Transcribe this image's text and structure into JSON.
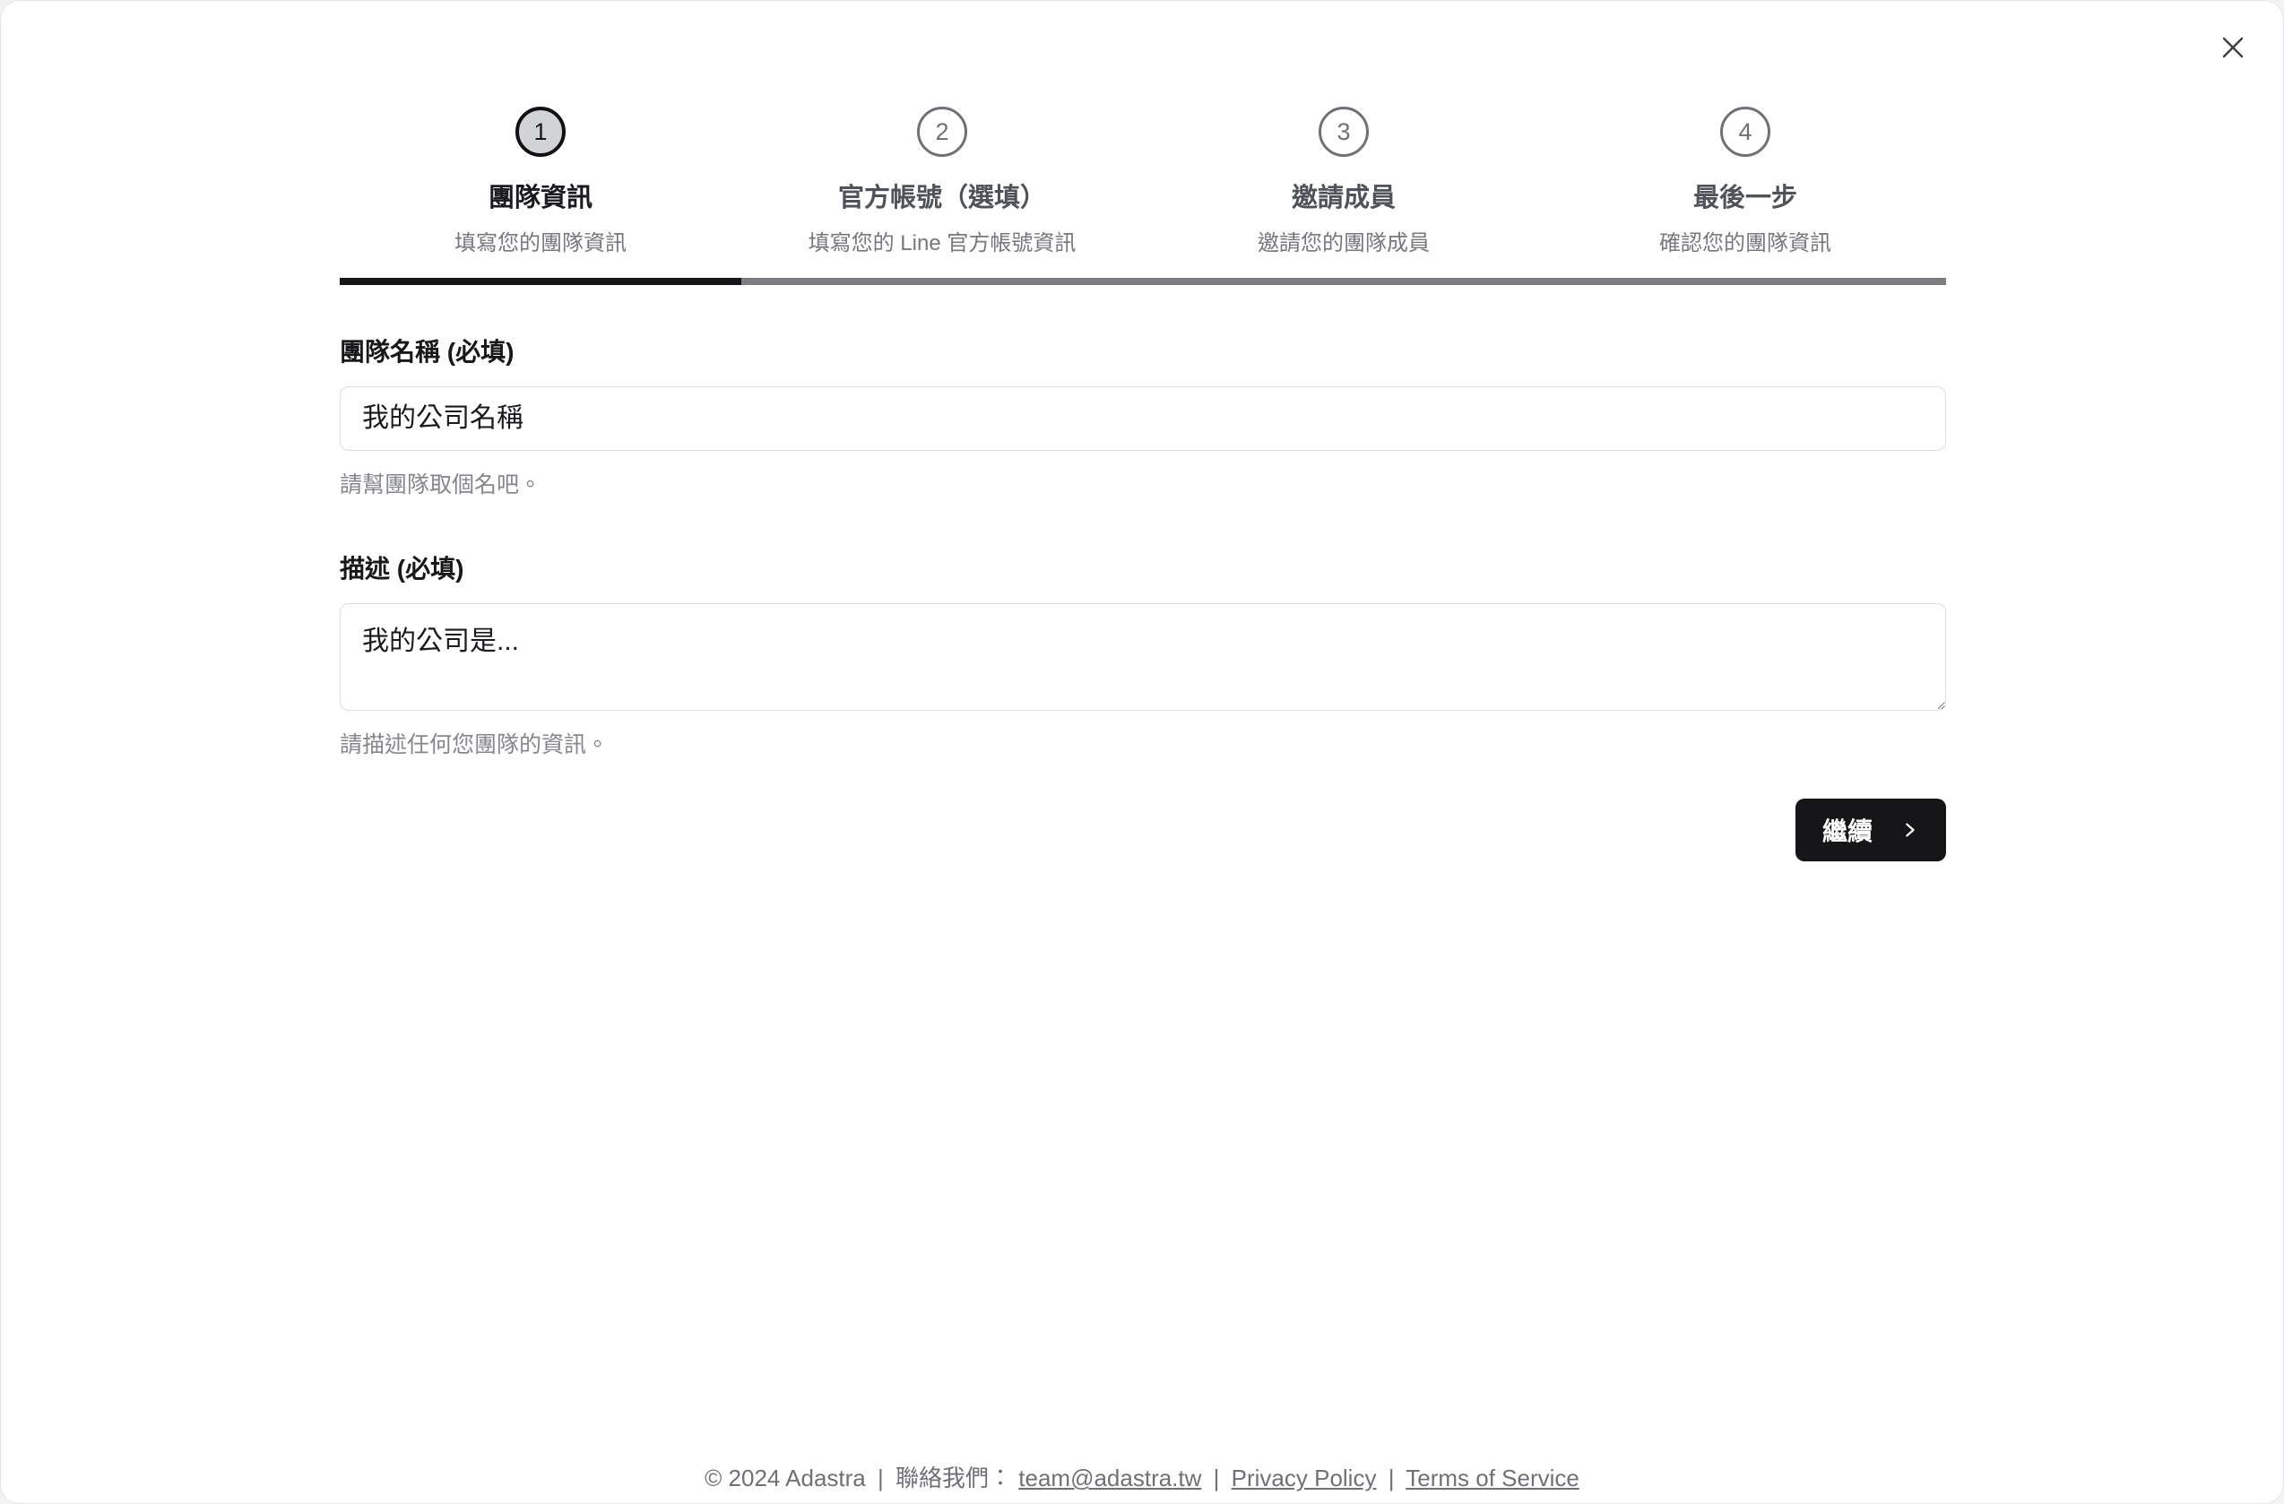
{
  "window": {
    "close_icon": "close-icon"
  },
  "stepper": {
    "current_step": 1,
    "total_steps": 4,
    "progress_percent": 25,
    "active_circle_fill": "#d2d3d5",
    "active_circle_border": "#111113",
    "inactive_color": "#6e7178",
    "progress_fill_color": "#161618",
    "progress_track_color": "#7c7e84",
    "steps": [
      {
        "number": "1",
        "title": "團隊資訊",
        "subtitle": "填寫您的團隊資訊"
      },
      {
        "number": "2",
        "title": "官方帳號（選填）",
        "subtitle": "填寫您的 Line 官方帳號資訊"
      },
      {
        "number": "3",
        "title": "邀請成員",
        "subtitle": "邀請您的團隊成員"
      },
      {
        "number": "4",
        "title": "最後一步",
        "subtitle": "確認您的團隊資訊"
      }
    ]
  },
  "form": {
    "team_name": {
      "label": "團隊名稱 (必填)",
      "value": "",
      "placeholder": "我的公司名稱",
      "help": "請幫團隊取個名吧。"
    },
    "description": {
      "label": "描述 (必填)",
      "value": "",
      "placeholder": "我的公司是...",
      "help": "請描述任何您團隊的資訊。"
    }
  },
  "actions": {
    "continue_label": "繼續",
    "continue_icon": "chevron-right-icon",
    "button_color": "#161618"
  },
  "footer": {
    "copyright": "© 2024 Adastra",
    "contact_label": "聯絡我們：",
    "email": "team@adastra.tw",
    "privacy_policy": "Privacy Policy",
    "terms_of_service": "Terms of Service",
    "separator": "|"
  }
}
